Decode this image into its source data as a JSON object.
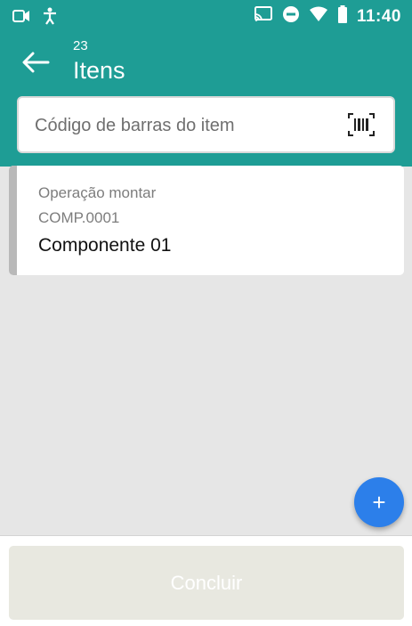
{
  "status_bar": {
    "time": "11:40",
    "icons": [
      "screen-record-icon",
      "accessibility-icon",
      "cast-icon",
      "dnd-icon",
      "wifi-icon",
      "battery-icon"
    ]
  },
  "header": {
    "count": "23",
    "title": "Itens",
    "background_color": "#1e9d95"
  },
  "search": {
    "placeholder": "Código de barras do item",
    "value": ""
  },
  "items": [
    {
      "operation": "Operação montar",
      "code": "COMP.0001",
      "name": "Componente 01"
    }
  ],
  "fab": {
    "label": "+"
  },
  "footer": {
    "conclude_label": "Concluir"
  }
}
